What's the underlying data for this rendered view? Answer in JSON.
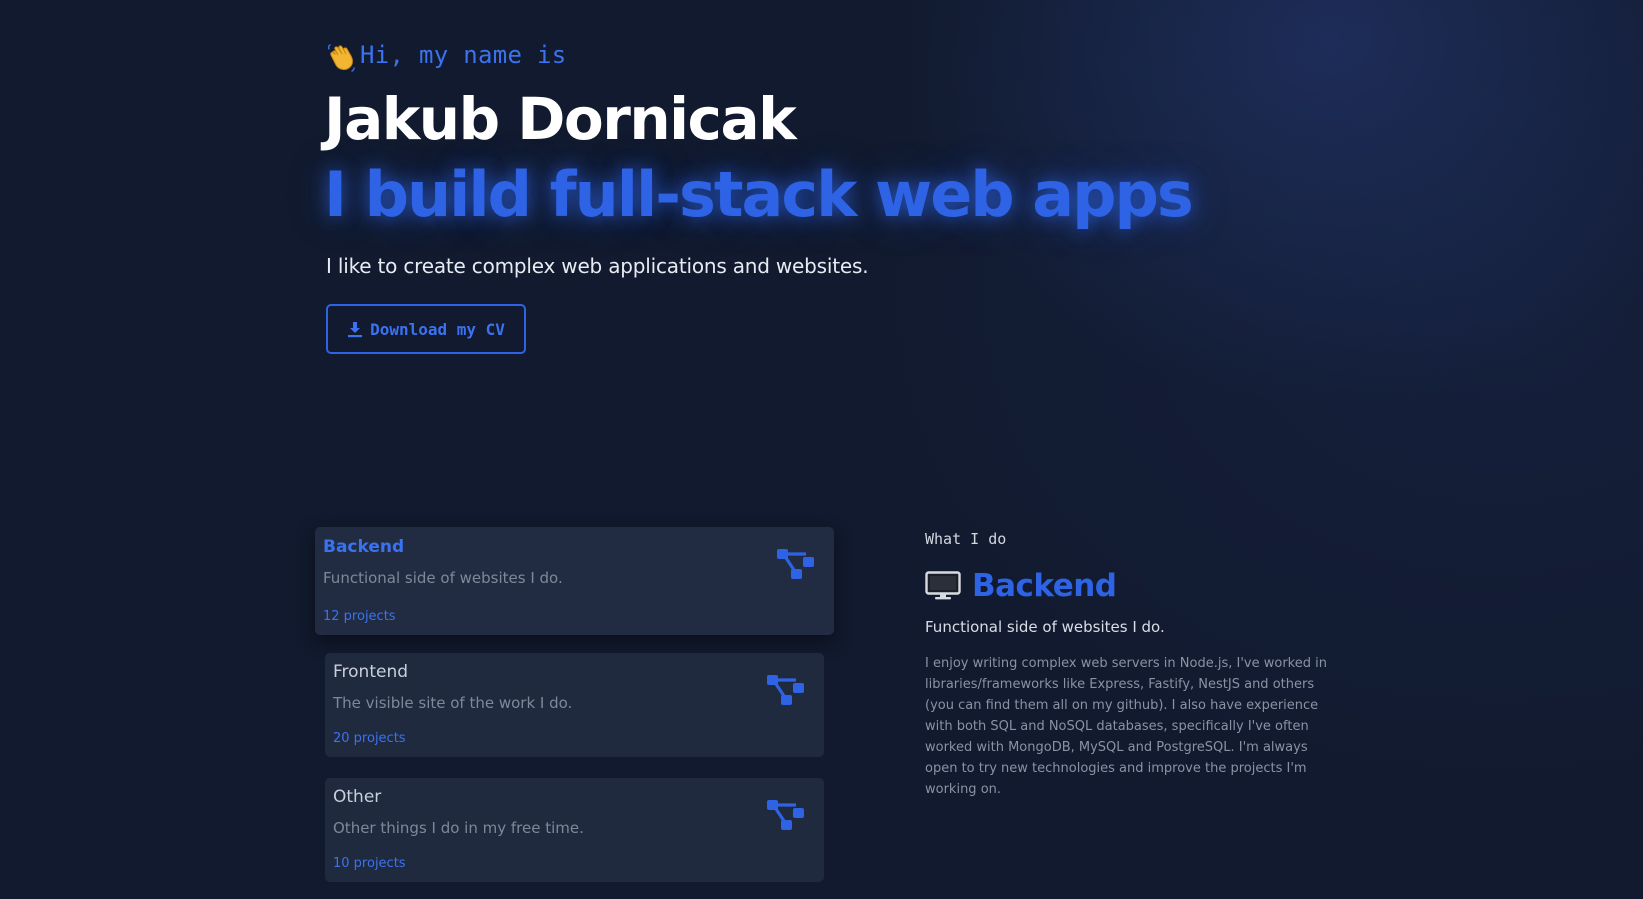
{
  "hero": {
    "greeting": "Hi, my name is",
    "name": "Jakub Dornicak",
    "tagline": "I build full-stack web apps",
    "lead": "I like to create complex web applications and websites.",
    "cv_button": "Download my CV",
    "wave_icon": "waving-hand-icon",
    "download_icon": "download-icon"
  },
  "services": [
    {
      "title": "Backend",
      "description": "Functional side of websites I do.",
      "count": "12 projects",
      "icon": "network-tree-icon",
      "active": true
    },
    {
      "title": "Frontend",
      "description": "The visible site of the work I do.",
      "count": "20 projects",
      "icon": "network-tree-icon",
      "active": false
    },
    {
      "title": "Other",
      "description": "Other things I do in my free time.",
      "count": "10 projects",
      "icon": "network-tree-icon",
      "active": false
    }
  ],
  "detail": {
    "eyebrow": "What I do",
    "icon": "monitor-icon",
    "title": "Backend",
    "subtitle": "Functional side of websites I do.",
    "body": "I enjoy writing complex web servers in Node.js, I've worked in libraries/frameworks like Express, Fastify, NestJS and others (you can find them all on my github). I also have experience with both SQL and NoSQL databases, specifically I've often worked with MongoDB, MySQL and PostgreSQL. I'm always open to try new technologies and improve the projects I'm working on."
  },
  "colors": {
    "background": "#111a2e",
    "accent": "#2d63e4",
    "accent_light": "#3b72f0",
    "card": "#1f2a3f",
    "text": "#e6e9f0",
    "muted": "#7f8899"
  }
}
